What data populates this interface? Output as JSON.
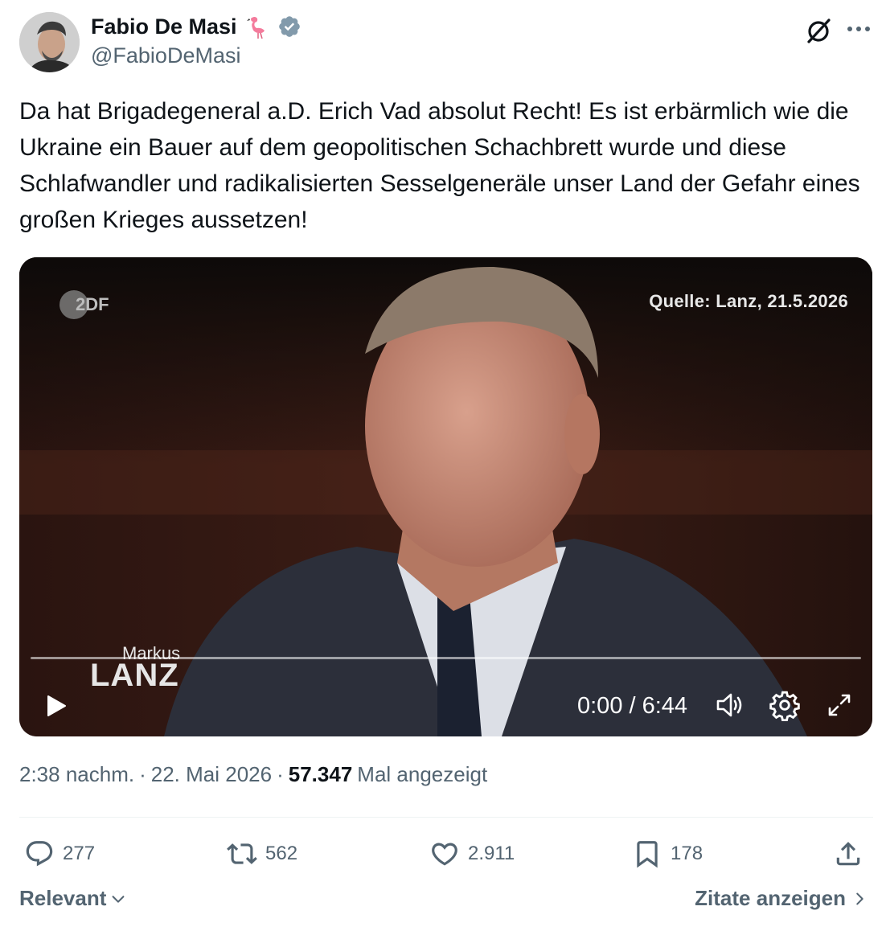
{
  "author": {
    "display_name": "Fabio De Masi",
    "handle": "@FabioDeMasi",
    "emoji_icon": "flamingo-icon",
    "verified_icon": "verified-badge-icon",
    "verified_color": "#829aab"
  },
  "header_actions": {
    "grok_icon": "grok-icon",
    "more_icon": "more-options-icon"
  },
  "tweet": {
    "text": "Da hat Brigadegeneral a.D. Erich Vad absolut Recht! Es ist erbärmlich wie die Ukraine ein Bauer auf dem geopolitischen Schachbrett wurde und diese Schlafwandler und radikalisierten Sesselgeneräle unser Land der Gefahr eines großen Krieges aussetzen!"
  },
  "video": {
    "channel_logo_text": "2DF",
    "source_label": "Quelle: Lanz, 21.5.2026",
    "show_logo_line1": "Markus",
    "show_logo_line2": "LANZ",
    "timecode": "0:00 / 6:44",
    "progress": 0,
    "controls": [
      "play-icon",
      "volume-icon",
      "settings-icon",
      "fullscreen-icon"
    ]
  },
  "meta": {
    "time": "2:38 nachm.",
    "separator": "·",
    "date": "22. Mai 2026",
    "views_count": "57.347",
    "views_label": "Mal angezeigt"
  },
  "actions": {
    "replies": "277",
    "retweets": "562",
    "likes": "2.911",
    "bookmarks": "178",
    "icon_color": "#536471"
  },
  "footer": {
    "sort_label": "Relevant",
    "quotes_label": "Zitate anzeigen"
  }
}
